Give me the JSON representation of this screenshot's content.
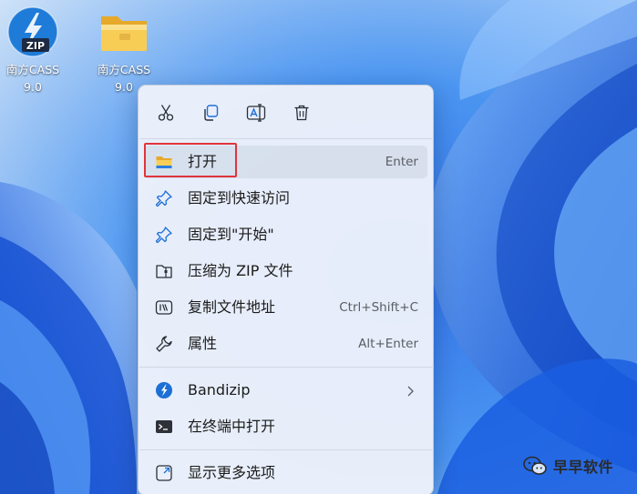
{
  "desktop": {
    "icons": [
      {
        "label_line1": "南方CASS",
        "label_line2": "9.0",
        "icon": "zip-archive-icon"
      },
      {
        "label_line1": "南方CASS",
        "label_line2": "9.0",
        "icon": "folder-icon"
      }
    ]
  },
  "context_menu": {
    "toolbar": [
      {
        "name": "cut",
        "icon": "scissors-icon"
      },
      {
        "name": "copy",
        "icon": "copy-icon"
      },
      {
        "name": "rename",
        "icon": "rename-icon"
      },
      {
        "name": "delete",
        "icon": "trash-icon"
      }
    ],
    "items": [
      {
        "label": "打开",
        "shortcut": "Enter",
        "icon": "folder-open-icon",
        "highlighted": true
      },
      {
        "label": "固定到快速访问",
        "shortcut": "",
        "icon": "pin-icon"
      },
      {
        "label": "固定到\"开始\"",
        "shortcut": "",
        "icon": "pin-icon"
      },
      {
        "label": "压缩为 ZIP 文件",
        "shortcut": "",
        "icon": "zip-folder-icon"
      },
      {
        "label": "复制文件地址",
        "shortcut": "Ctrl+Shift+C",
        "icon": "path-icon"
      },
      {
        "label": "属性",
        "shortcut": "Alt+Enter",
        "icon": "wrench-icon"
      },
      {
        "label": "Bandizip",
        "shortcut": "",
        "icon": "bandizip-icon",
        "has_submenu": true
      },
      {
        "label": "在终端中打开",
        "shortcut": "",
        "icon": "terminal-icon"
      },
      {
        "label": "显示更多选项",
        "shortcut": "",
        "icon": "more-options-icon"
      }
    ]
  },
  "watermark": {
    "text": "早早软件",
    "icon": "wechat-icon"
  },
  "colors": {
    "highlight_border": "#e0353b",
    "accent": "#1f6fd6"
  }
}
